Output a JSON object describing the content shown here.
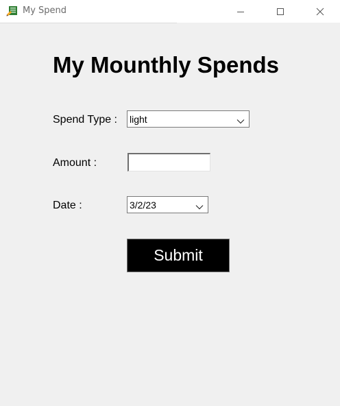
{
  "window": {
    "title": "My Spend",
    "icon": "notepad-app-icon"
  },
  "form": {
    "heading": "My Mounthly Spends",
    "spend_type": {
      "label": "Spend Type :",
      "selected": "light"
    },
    "amount": {
      "label": "Amount :",
      "value": ""
    },
    "date": {
      "label": "Date :",
      "selected": "3/2/23"
    },
    "submit_label": "Submit"
  },
  "colors": {
    "window_bg": "#f0f0f0",
    "titlebar_bg": "#ffffff",
    "button_bg": "#000000",
    "button_text": "#ffffff"
  }
}
